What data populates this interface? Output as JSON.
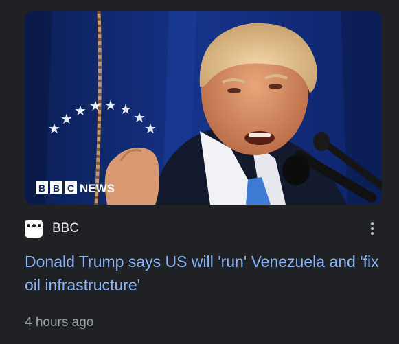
{
  "article": {
    "thumbnail": {
      "description_icon": "news-photo",
      "watermark": "BBC NEWS"
    },
    "source": {
      "name": "BBC",
      "favicon_icon": "bbc-favicon-icon"
    },
    "headline": "Donald Trump says US will 'run' Venezuela and 'fix oil infrastructure'",
    "timestamp": "4 hours ago",
    "more_icon": "more-vert-icon"
  },
  "colors": {
    "background": "#202124",
    "headline_link": "#8ab4f8",
    "source_text": "#e8eaed",
    "muted_text": "#9aa0a6"
  }
}
